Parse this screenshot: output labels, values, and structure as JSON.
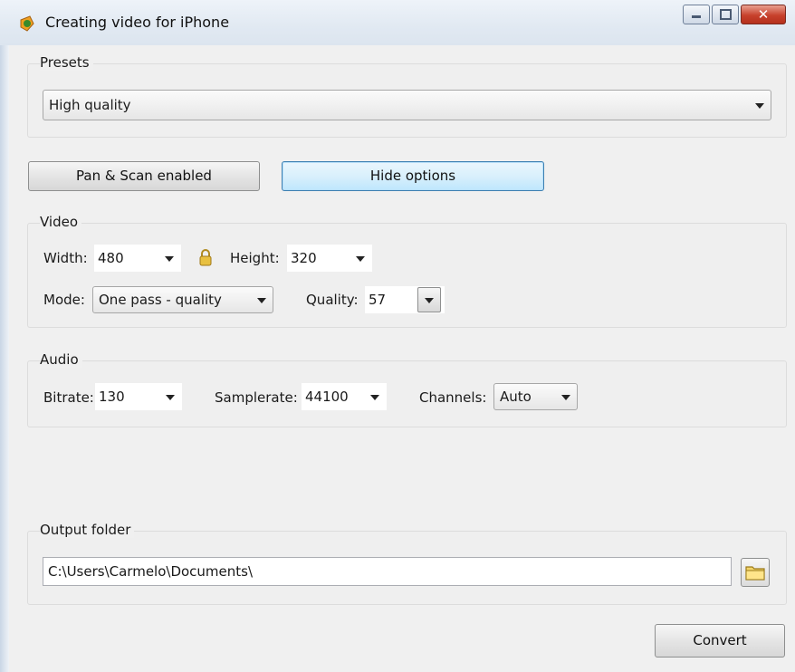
{
  "window": {
    "title": "Creating video for iPhone",
    "close_glyph": "✕",
    "icons": {
      "app": "app-icon",
      "minimize": "minimize-icon",
      "maximize": "maximize-icon",
      "close": "close-icon"
    }
  },
  "presets": {
    "legend": "Presets",
    "selected": "High quality"
  },
  "buttons": {
    "pan_scan": "Pan & Scan enabled",
    "hide_options": "Hide options",
    "convert": "Convert"
  },
  "video": {
    "legend": "Video",
    "width_label": "Width:",
    "width_value": "480",
    "height_label": "Height:",
    "height_value": "320",
    "lock_icon": "lock-icon",
    "mode_label": "Mode:",
    "mode_value": "One pass - quality",
    "quality_label": "Quality:",
    "quality_value": "57"
  },
  "audio": {
    "legend": "Audio",
    "bitrate_label": "Bitrate:",
    "bitrate_value": "130",
    "samplerate_label": "Samplerate:",
    "samplerate_value": "44100",
    "channels_label": "Channels:",
    "channels_value": "Auto"
  },
  "output": {
    "legend": "Output folder",
    "path": "C:\\Users\\Carmelo\\Documents\\",
    "folder_icon": "folder-icon"
  },
  "colors": {
    "hot_button_border": "#3c7fb1",
    "close_button": "#c7412c"
  }
}
